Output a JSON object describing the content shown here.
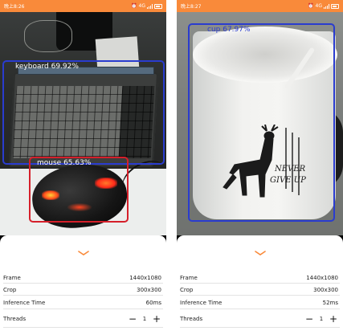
{
  "left_screen": {
    "status_time": "晚上8:26",
    "status_network": "4G",
    "detections": [
      {
        "label": "keyboard 69.92%",
        "color": "#2a3ccf"
      },
      {
        "label": "mouse 65.63%",
        "color": "#d51f2a"
      }
    ],
    "info": {
      "frame_label": "Frame",
      "frame_value": "1440x1080",
      "crop_label": "Crop",
      "crop_value": "300x300",
      "inference_label": "Inference Time",
      "inference_value": "60ms",
      "threads_label": "Threads",
      "threads_value": "1",
      "minus": "−",
      "plus": "+"
    }
  },
  "right_screen": {
    "status_time": "晚上8:27",
    "status_network": "4G",
    "detections": [
      {
        "label": "cup 67.97%",
        "color": "#2a3ccf"
      }
    ],
    "info": {
      "frame_label": "Frame",
      "frame_value": "1440x1080",
      "crop_label": "Crop",
      "crop_value": "300x300",
      "inference_label": "Inference Time",
      "inference_value": "52ms",
      "threads_label": "Threads",
      "threads_value": "1",
      "minus": "−",
      "plus": "+"
    }
  },
  "cup_print": "NEVER GIVE UP",
  "colors": {
    "status_bar": "#f98a3a",
    "chevron": "#f98a3a",
    "box_blue": "#2a3ccf",
    "box_red": "#d51f2a"
  },
  "icons": [
    "alarm-icon",
    "signal-icon",
    "battery-icon",
    "expand-chevron-icon",
    "minus-icon",
    "plus-icon"
  ]
}
